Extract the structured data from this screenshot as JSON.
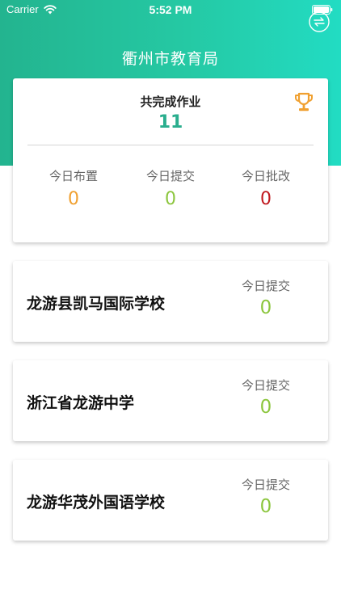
{
  "status_bar": {
    "carrier": "Carrier",
    "time": "5:52 PM"
  },
  "header": {
    "title": "衢州市教育局",
    "switch_icon": "switch-arrows-icon"
  },
  "summary": {
    "label": "共完成作业",
    "total": "11",
    "icon": "trophy-icon",
    "stats": [
      {
        "label": "今日布置",
        "value": "0",
        "color": "#f0a030"
      },
      {
        "label": "今日提交",
        "value": "0",
        "color": "#8cc63e"
      },
      {
        "label": "今日批改",
        "value": "0",
        "color": "#c0191f"
      }
    ]
  },
  "schools": [
    {
      "name": "龙游县凯马国际学校",
      "stat_label": "今日提交",
      "stat_value": "0"
    },
    {
      "name": "浙江省龙游中学",
      "stat_label": "今日提交",
      "stat_value": "0"
    },
    {
      "name": "龙游华茂外国语学校",
      "stat_label": "今日提交",
      "stat_value": "0"
    }
  ],
  "colors": {
    "accent": "#25c9a4",
    "total": "#2aae8e",
    "submit": "#8cc63e",
    "trophy": "#f0a030"
  }
}
